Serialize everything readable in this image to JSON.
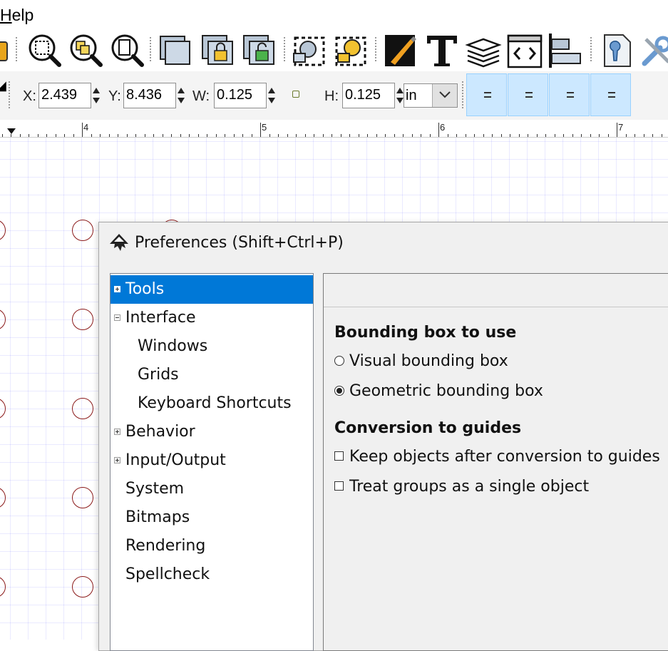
{
  "menubar": {
    "help_label": "Help",
    "help_mnemonic": "H",
    "help_rest": "elp"
  },
  "toolbar": {
    "icons": [
      "import-icon",
      "zoom-selection-icon",
      "zoom-drawing-icon",
      "zoom-page-icon",
      "duplicate-icon",
      "clone-icon",
      "unlink-clone-icon",
      "group-icon",
      "ungroup-icon",
      "fill-stroke-icon",
      "text-font-icon",
      "layers-icon",
      "xml-editor-icon",
      "align-distribute-icon",
      "document-properties-icon",
      "preferences-icon"
    ]
  },
  "controls": {
    "x_label": "X:",
    "x_value": "2.439",
    "y_label": "Y:",
    "y_value": "8.436",
    "w_label": "W:",
    "w_value": "0.125",
    "h_label": "H:",
    "h_value": "0.125",
    "unit": "in"
  },
  "ruler": {
    "labels": [
      "4",
      "5",
      "6",
      "7"
    ]
  },
  "dialog": {
    "title": "Preferences (Shift+Ctrl+P)",
    "tree": [
      {
        "label": "Tools",
        "expander": "plus",
        "selected": true,
        "indent": 0
      },
      {
        "label": "Interface",
        "expander": "minus",
        "selected": false,
        "indent": 0
      },
      {
        "label": "Windows",
        "expander": "none",
        "selected": false,
        "indent": 1
      },
      {
        "label": "Grids",
        "expander": "none",
        "selected": false,
        "indent": 1
      },
      {
        "label": "Keyboard Shortcuts",
        "expander": "none",
        "selected": false,
        "indent": 1
      },
      {
        "label": "Behavior",
        "expander": "plus",
        "selected": false,
        "indent": 0
      },
      {
        "label": "Input/Output",
        "expander": "plus",
        "selected": false,
        "indent": 0
      },
      {
        "label": "System",
        "expander": "none",
        "selected": false,
        "indent": 0
      },
      {
        "label": "Bitmaps",
        "expander": "none",
        "selected": false,
        "indent": 0
      },
      {
        "label": "Rendering",
        "expander": "none",
        "selected": false,
        "indent": 0
      },
      {
        "label": "Spellcheck",
        "expander": "none",
        "selected": false,
        "indent": 0
      }
    ],
    "bbox_heading": "Bounding box to use",
    "bbox_visual": "Visual bounding box",
    "bbox_geometric": "Geometric bounding box",
    "bbox_selected": "geometric",
    "guides_heading": "Conversion to guides",
    "keep_objects": "Keep objects after conversion to guides",
    "keep_objects_checked": false,
    "treat_groups": "Treat groups as a single object",
    "treat_groups_checked": false
  },
  "colors": {
    "selection": "#0078d7",
    "align_active": "#cce8ff",
    "circle_stroke": "#8b1a1a"
  }
}
